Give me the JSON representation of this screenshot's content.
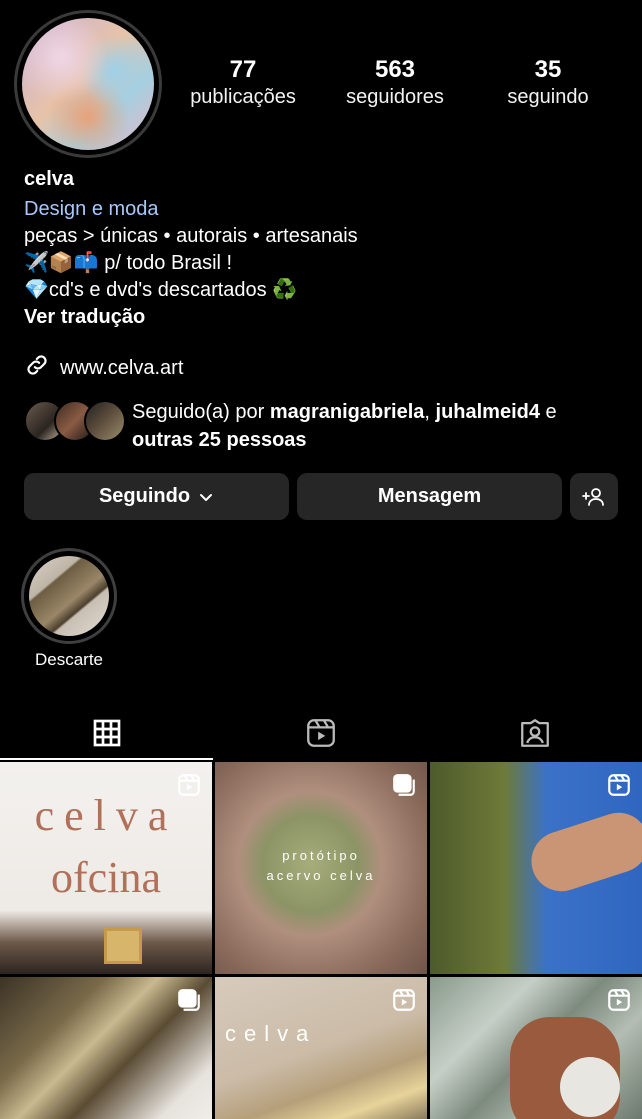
{
  "profile": {
    "username": "celva",
    "stats": [
      {
        "value": "77",
        "label": "publicações"
      },
      {
        "value": "563",
        "label": "seguidores"
      },
      {
        "value": "35",
        "label": "seguindo"
      }
    ],
    "category": "Design e moda",
    "bio_lines": [
      "peças > únicas • autorais • artesanais",
      "✈️📦📫 p/ todo Brasil !",
      "💎cd's e dvd's descartados ♻️"
    ],
    "translate_label": "Ver tradução",
    "website": "www.celva.art",
    "followed_by": {
      "prefix": "Seguido(a) por ",
      "user1": "magranigabriela",
      "separator": ", ",
      "user2": "juhalmeid4",
      "joiner": " e",
      "others": "outras 25 pessoas"
    }
  },
  "buttons": {
    "following": "Seguindo",
    "message": "Mensagem"
  },
  "highlights": [
    {
      "label": "Descarte"
    }
  ],
  "grid": {
    "posts": [
      {
        "text": "celva\nofcina",
        "type": "reel"
      },
      {
        "text": "protótipo\nacervo celva",
        "type": "carousel"
      },
      {
        "text": "",
        "type": "reel"
      },
      {
        "text": "",
        "type": "carousel"
      },
      {
        "text": "celva",
        "type": "reel"
      },
      {
        "text": "",
        "type": "reel"
      }
    ],
    "post1_line1": "celva",
    "post1_line2": "ofcina",
    "post2_line1": "protótipo",
    "post2_line2": "acervo celva",
    "post5_text": "celva"
  },
  "icons": {
    "link": "link-icon",
    "chevron": "chevron-down-icon",
    "add_person": "add-person-icon",
    "grid_tab": "grid-icon",
    "reels_tab": "reels-icon",
    "tagged_tab": "tagged-icon"
  }
}
